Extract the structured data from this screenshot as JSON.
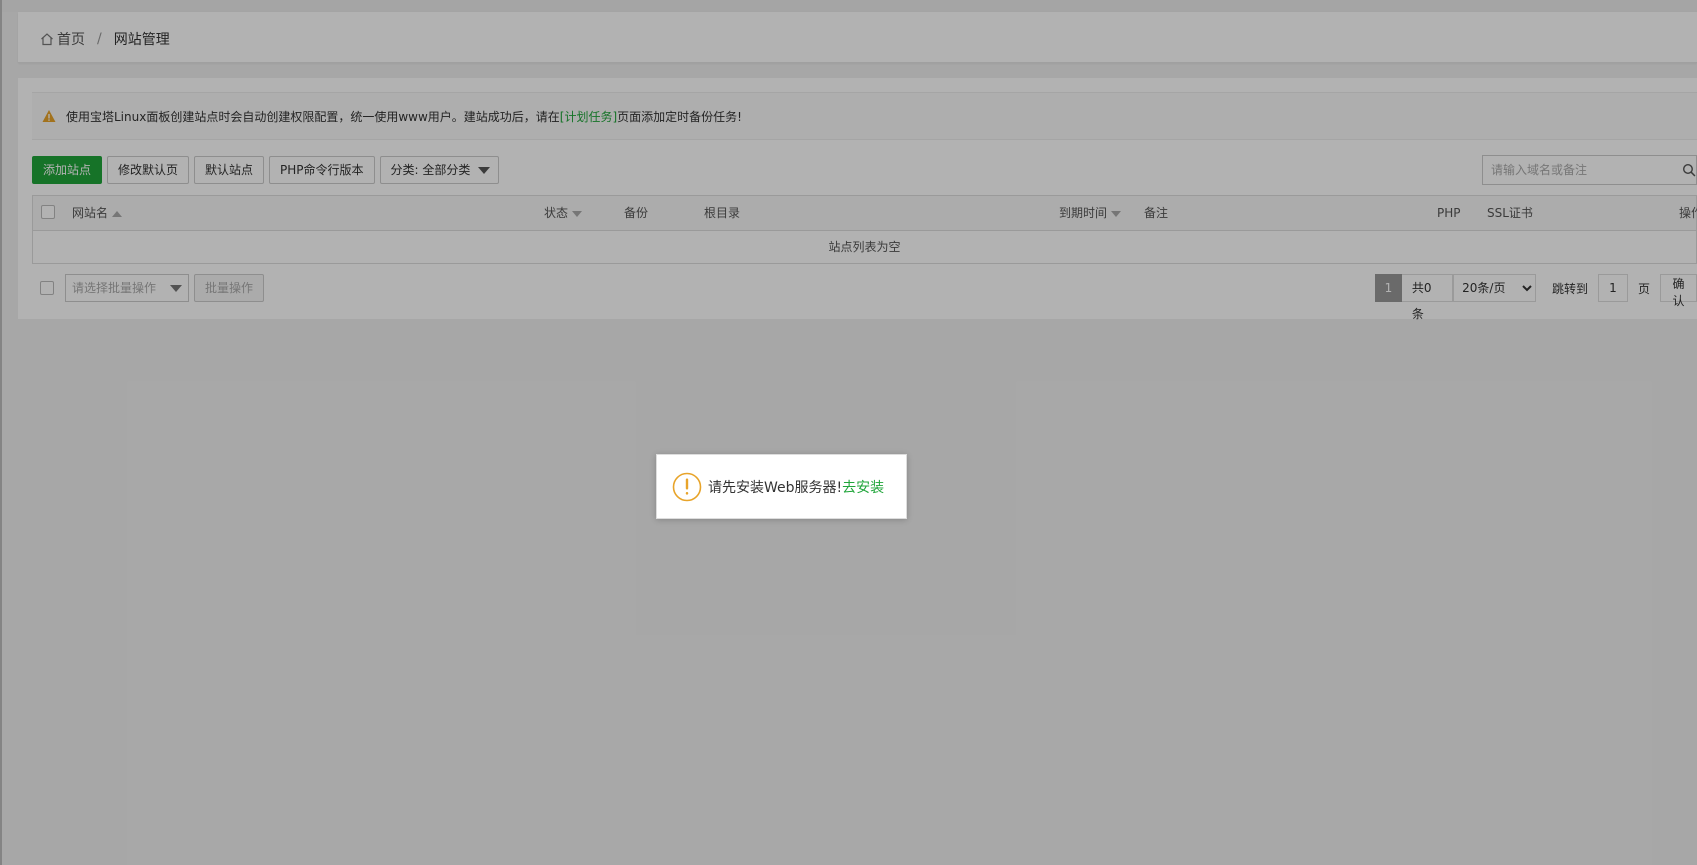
{
  "breadcrumb": {
    "home": "首页",
    "separator": "/",
    "current": "网站管理"
  },
  "notice": {
    "text_before": "使用宝塔Linux面板创建站点时会自动创建权限配置，统一使用www用户。建站成功后，请在",
    "link": "[计划任务]",
    "text_after": "页面添加定时备份任务!"
  },
  "toolbar": {
    "add_site": "添加站点",
    "edit_default_page": "修改默认页",
    "default_site": "默认站点",
    "php_cli_version": "PHP命令行版本",
    "category_select": "分类: 全部分类"
  },
  "search": {
    "placeholder": "请输入域名或备注"
  },
  "table": {
    "columns": {
      "site_name": "网站名",
      "status": "状态",
      "backup": "备份",
      "root_dir": "根目录",
      "expire_time": "到期时间",
      "remark": "备注",
      "php": "PHP",
      "ssl": "SSL证书",
      "actions": "操作"
    },
    "empty_text": "站点列表为空"
  },
  "footer": {
    "batch_placeholder": "请选择批量操作",
    "batch_button": "批量操作",
    "current_page": "1",
    "total": "共0条",
    "page_size": "20条/页",
    "jump_label": "跳转到",
    "jump_value": "1",
    "page_unit": "页",
    "confirm": "确认"
  },
  "dialog": {
    "message": "请先安装Web服务器!",
    "link": "去安装"
  },
  "colors": {
    "accent": "#20a53a",
    "warning": "#e8a42a"
  }
}
